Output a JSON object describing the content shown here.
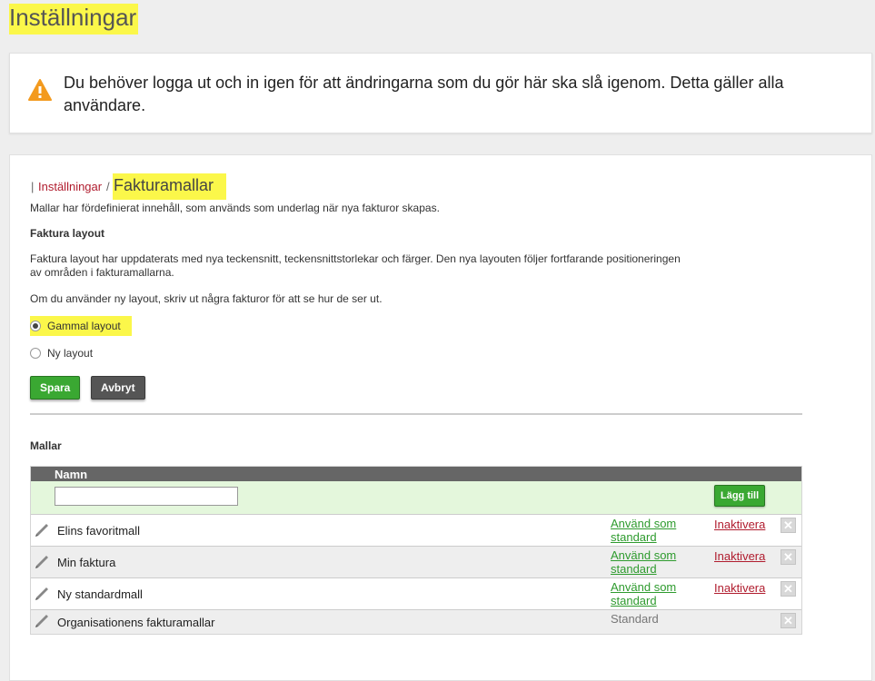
{
  "page": {
    "title": "Inställningar"
  },
  "notice": {
    "text": "Du behöver logga ut och in igen för att ändringarna som du gör här ska slå igenom. Detta gäller alla användare."
  },
  "breadcrumb": {
    "separator": "|",
    "parent": "Inställningar",
    "slash": "/",
    "current": "Fakturamallar"
  },
  "intro": "Mallar har fördefinierat innehåll, som används som underlag när nya fakturor skapas.",
  "layout": {
    "heading": "Faktura layout",
    "description": "Faktura layout har uppdaterats med nya teckensnitt, teckensnittstorlekar och färger. Den nya layouten följer fortfarande positioneringen av områden i fakturamallarna.",
    "tip": "Om du använder ny layout, skriv ut några fakturor för att se hur de ser ut.",
    "option_old": "Gammal layout",
    "option_new": "Ny layout",
    "selected": "Gammal layout"
  },
  "buttons": {
    "save": "Spara",
    "cancel": "Avbryt"
  },
  "templates": {
    "heading": "Mallar",
    "column_name": "Namn",
    "name_input_value": "",
    "add_label": "Lägg till",
    "use_line1": "Använd som",
    "use_line2": "standard",
    "inactivate": "Inaktivera",
    "standard_label": "Standard",
    "delete_glyph": "✕",
    "rows": [
      {
        "name": "Elins favoritmall"
      },
      {
        "name": "Min faktura"
      },
      {
        "name": "Ny standardmall"
      },
      {
        "name": "Organisationens fakturamallar"
      }
    ]
  },
  "colors": {
    "accent_green": "#3aa832",
    "link_red": "#b01c2e",
    "highlight": "#fbf74a",
    "warning": "#f39a1e"
  }
}
